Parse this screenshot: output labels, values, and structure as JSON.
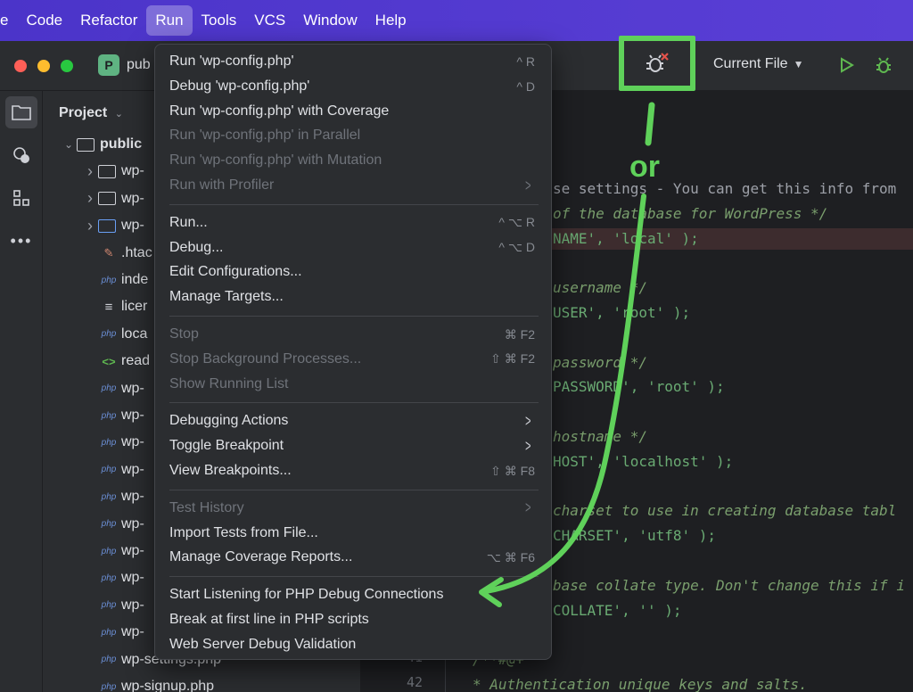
{
  "menubar": {
    "items": [
      "e",
      "Code",
      "Refactor",
      "Run",
      "Tools",
      "VCS",
      "Window",
      "Help"
    ],
    "active": "Run"
  },
  "titlebar": {
    "project_badge": "P",
    "project_name": "pub",
    "run_config": "Current File"
  },
  "project_panel": {
    "title": "Project",
    "tree": [
      {
        "name": "public",
        "kind": "folder-open",
        "bold": true
      },
      {
        "name": "wp-",
        "kind": "folder"
      },
      {
        "name": "wp-",
        "kind": "folder"
      },
      {
        "name": "wp-",
        "kind": "folder-blue"
      },
      {
        "name": ".htac",
        "kind": "htaccess"
      },
      {
        "name": "inde",
        "kind": "php"
      },
      {
        "name": "licer",
        "kind": "txt"
      },
      {
        "name": "loca",
        "kind": "php"
      },
      {
        "name": "read",
        "kind": "md"
      },
      {
        "name": "wp-",
        "kind": "php"
      },
      {
        "name": "wp-",
        "kind": "php"
      },
      {
        "name": "wp-",
        "kind": "php"
      },
      {
        "name": "wp-",
        "kind": "php"
      },
      {
        "name": "wp-",
        "kind": "php"
      },
      {
        "name": "wp-",
        "kind": "php"
      },
      {
        "name": "wp-",
        "kind": "php"
      },
      {
        "name": "wp-",
        "kind": "php"
      },
      {
        "name": "wp-",
        "kind": "php"
      },
      {
        "name": "wp-",
        "kind": "php"
      },
      {
        "name": "wp-settings.php",
        "kind": "php"
      },
      {
        "name": "wp-signup.php",
        "kind": "php"
      }
    ]
  },
  "editor": {
    "lines": [
      {
        "parts": [
          [
            "se settings - You can get this info from",
            "cmp"
          ]
        ]
      },
      {
        "parts": [
          [
            "of the database for WordPress */",
            "cm"
          ]
        ]
      },
      {
        "parts": [
          [
            "NAME', 'local' );",
            "str"
          ]
        ],
        "highlight": true
      },
      {
        "parts": [
          [
            "",
            "pl"
          ]
        ]
      },
      {
        "parts": [
          [
            "username */",
            "cm"
          ]
        ]
      },
      {
        "parts": [
          [
            "USER', 'root' );",
            "str"
          ]
        ]
      },
      {
        "parts": [
          [
            "",
            "pl"
          ]
        ]
      },
      {
        "parts": [
          [
            "password */",
            "cm"
          ]
        ]
      },
      {
        "parts": [
          [
            "PASSWORD', 'root' );",
            "str"
          ]
        ]
      },
      {
        "parts": [
          [
            "",
            "pl"
          ]
        ]
      },
      {
        "parts": [
          [
            "hostname */",
            "cm"
          ]
        ]
      },
      {
        "parts": [
          [
            "HOST', 'localhost' );",
            "str"
          ]
        ]
      },
      {
        "parts": [
          [
            "",
            "pl"
          ]
        ]
      },
      {
        "parts": [
          [
            "charset to use in creating database tabl",
            "cm"
          ]
        ]
      },
      {
        "parts": [
          [
            "CHARSET', 'utf8' );",
            "str"
          ]
        ]
      },
      {
        "parts": [
          [
            "",
            "pl"
          ]
        ]
      },
      {
        "parts": [
          [
            "base collate type. Don't change this if i",
            "cm"
          ]
        ]
      },
      {
        "parts": [
          [
            "COLLATE', '' );",
            "str"
          ]
        ]
      },
      {
        "parts": [
          [
            "",
            "pl"
          ]
        ]
      },
      {
        "parts": [
          [
            "/**#@+",
            "cm"
          ]
        ],
        "num": "41"
      },
      {
        "parts": [
          [
            "* Authentication unique keys and salts.",
            "cm"
          ]
        ],
        "num": "42"
      }
    ]
  },
  "run_menu": {
    "groups": [
      [
        {
          "label": "Run 'wp-config.php'",
          "shortcut": "^ R"
        },
        {
          "label": "Debug 'wp-config.php'",
          "shortcut": "^ D"
        },
        {
          "label": "Run 'wp-config.php' with Coverage",
          "shortcut": ""
        },
        {
          "label": "Run 'wp-config.php' in Parallel",
          "shortcut": "",
          "disabled": true
        },
        {
          "label": "Run 'wp-config.php' with Mutation",
          "shortcut": "",
          "disabled": true
        },
        {
          "label": "Run with Profiler",
          "shortcut": "",
          "disabled": true,
          "submenu": true
        }
      ],
      [
        {
          "label": "Run...",
          "shortcut": "^ ⌥ R"
        },
        {
          "label": "Debug...",
          "shortcut": "^ ⌥ D"
        },
        {
          "label": "Edit Configurations...",
          "shortcut": ""
        },
        {
          "label": "Manage Targets...",
          "shortcut": ""
        }
      ],
      [
        {
          "label": "Stop",
          "shortcut": "⌘ F2",
          "disabled": true
        },
        {
          "label": "Stop Background Processes...",
          "shortcut": "⇧ ⌘ F2",
          "disabled": true
        },
        {
          "label": "Show Running List",
          "shortcut": "",
          "disabled": true
        }
      ],
      [
        {
          "label": "Debugging Actions",
          "shortcut": "",
          "submenu": true
        },
        {
          "label": "Toggle Breakpoint",
          "shortcut": "",
          "submenu": true
        },
        {
          "label": "View Breakpoints...",
          "shortcut": "⇧ ⌘ F8"
        }
      ],
      [
        {
          "label": "Test History",
          "shortcut": "",
          "disabled": true,
          "submenu": true
        },
        {
          "label": "Import Tests from File...",
          "shortcut": ""
        },
        {
          "label": "Manage Coverage Reports...",
          "shortcut": "⌥ ⌘ F6"
        }
      ],
      [
        {
          "label": "Start Listening for PHP Debug Connections",
          "shortcut": ""
        },
        {
          "label": "Break at first line in PHP scripts",
          "shortcut": ""
        },
        {
          "label": "Web Server Debug Validation",
          "shortcut": ""
        }
      ]
    ]
  },
  "annotation": {
    "or_label": "or",
    "accent": "#5fd15a"
  }
}
